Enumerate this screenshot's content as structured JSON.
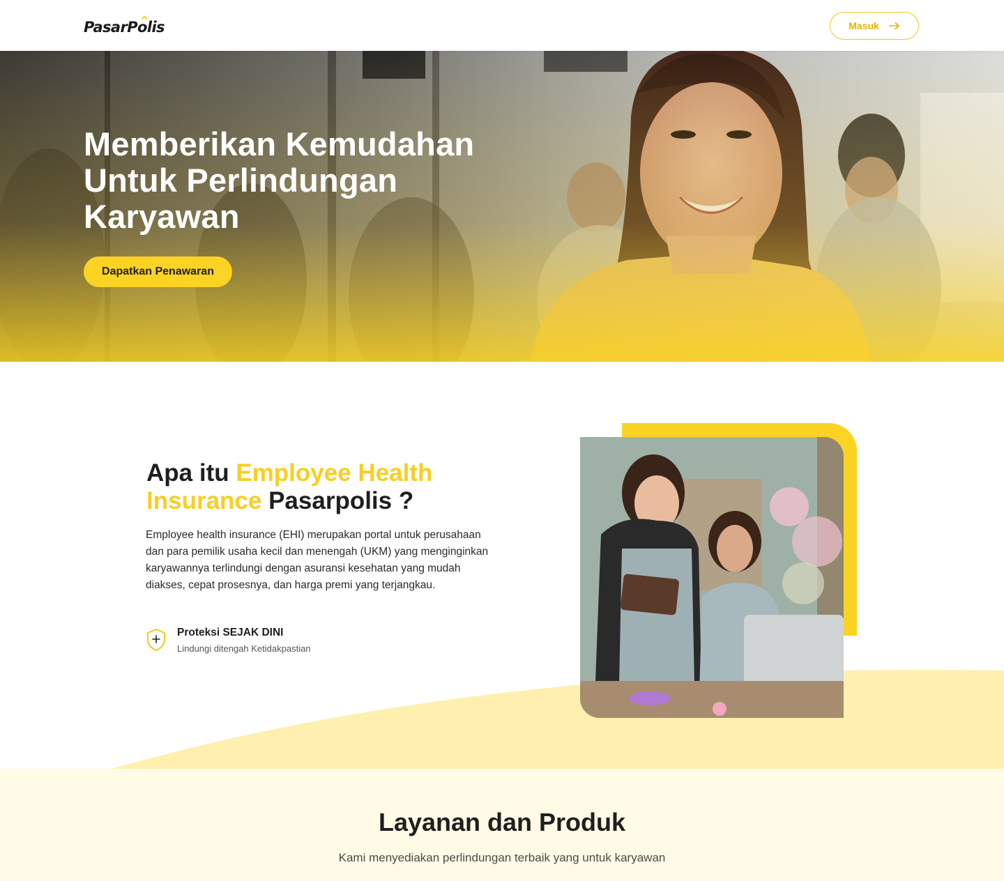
{
  "brand": {
    "name": "PasarPolis",
    "accent": "#fbd323",
    "accent_dark": "#e5b400"
  },
  "header": {
    "login_label": "Masuk",
    "login_icon": "arrow-right-icon"
  },
  "hero": {
    "title_lines": [
      "Memberikan Kemudahan",
      "Untuk Perlindungan",
      "Karyawan"
    ],
    "cta_label": "Dapatkan Penawaran"
  },
  "about": {
    "title_part1": "Apa itu ",
    "title_highlight": "Employee Health Insurance",
    "title_part2": " Pasarpolis ?",
    "description": "Employee health insurance (EHI) merupakan portal untuk perusahaan dan para pemilik usaha kecil dan menengah (UKM) yang menginginkan karyawannya terlindungi dengan asuransi kesehatan yang mudah diakses, cepat prosesnya, dan harga premi yang terjangkau.",
    "feature": {
      "icon": "shield-plus-icon",
      "title": "Proteksi SEJAK DINI",
      "subtitle": "Lindungi ditengah Ketidakpastian"
    }
  },
  "products": {
    "title": "Layanan dan Produk",
    "subtitle": "Kami menyediakan perlindungan terbaik yang untuk karyawan"
  }
}
